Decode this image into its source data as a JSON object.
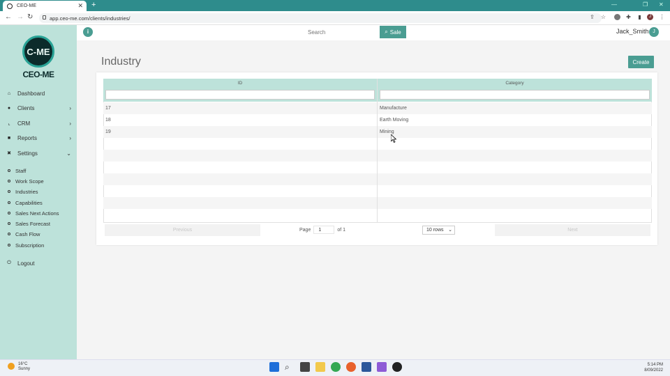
{
  "browser": {
    "tab_title": "CEO-ME",
    "tab_close": "✕",
    "new_tab": "+",
    "url": "app.ceo-me.com/clients/industries/"
  },
  "sidebar": {
    "logo_text": "C-ME",
    "brand": "CEO-ME",
    "items": [
      {
        "label": "Dashboard",
        "icon": "home-icon"
      },
      {
        "label": "Clients",
        "icon": "dot-icon",
        "has_chevron": true
      },
      {
        "label": "CRM",
        "icon": "chart-icon",
        "has_chevron": true
      },
      {
        "label": "Reports",
        "icon": "book-icon",
        "has_chevron": true
      },
      {
        "label": "Settings",
        "icon": "tools-icon",
        "expanded": true
      }
    ],
    "settings_items": [
      "Staff",
      "Work Scope",
      "Industries",
      "Capabilities",
      "Sales Next Actions",
      "Sales Forecast",
      "Cash Flow",
      "Subscription"
    ],
    "logout": "Logout"
  },
  "header": {
    "search_placeholder": "Search",
    "sale_button": "Sale",
    "username": "Jack_Smith",
    "avatar_initial": "J"
  },
  "main": {
    "title": "Industry",
    "create_button": "Create",
    "columns": [
      "ID",
      "Category"
    ],
    "rows": [
      {
        "id": "17",
        "category": "Manufacture"
      },
      {
        "id": "18",
        "category": "Earth Moving"
      },
      {
        "id": "19",
        "category": "Mining"
      }
    ],
    "pagination": {
      "previous": "Previous",
      "page_label": "Page",
      "page_value": "1",
      "of_label": "of 1",
      "rows_select": "10 rows",
      "next": "Next"
    }
  },
  "taskbar": {
    "weather_temp": "16°C",
    "weather_desc": "Sunny",
    "time": "5:14 PM",
    "date": "8/09/2022"
  },
  "colors": {
    "accent": "#4a9d92",
    "sidebar_bg": "#bde2da",
    "browser_bar": "#2e8c8c"
  }
}
